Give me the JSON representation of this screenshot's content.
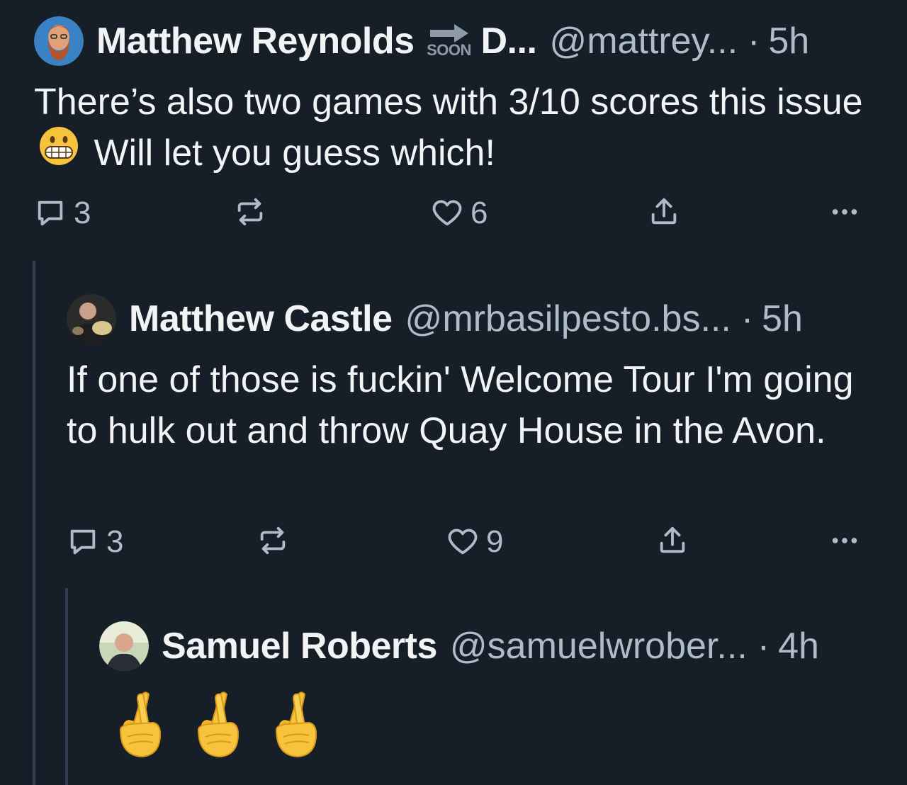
{
  "posts": [
    {
      "author_name": "Matthew Reynolds",
      "badge_label": "SOON",
      "display_suffix": "D...",
      "handle": "@mattrey...",
      "separator": "·",
      "time": "5h",
      "text_part1": "There’s also two games with 3/10 scores this issue",
      "text_part2": "Will let you guess which!",
      "inline_emoji": "grimacing-face",
      "replies": "3",
      "likes": "6"
    },
    {
      "author_name": "Matthew Castle",
      "handle": "@mrbasilpesto.bs...",
      "separator": "·",
      "time": "5h",
      "text": "If one of those is fuckin' Welcome Tour I'm going to hulk out and throw Quay House in the Avon.",
      "replies": "3",
      "likes": "9"
    },
    {
      "author_name": "Samuel Roberts",
      "handle": "@samuelwrober...",
      "separator": "·",
      "time": "4h",
      "emoji": [
        "crossed-fingers",
        "crossed-fingers",
        "crossed-fingers"
      ]
    }
  ],
  "icons": {
    "reply": "reply-icon",
    "repost": "repost-icon",
    "like": "heart-icon",
    "share": "share-icon",
    "more": "more-icon"
  },
  "colors": {
    "background": "#161e27",
    "text": "#f1f3f5",
    "muted": "#aebbc9",
    "thread_line": "#2e3d4f"
  }
}
